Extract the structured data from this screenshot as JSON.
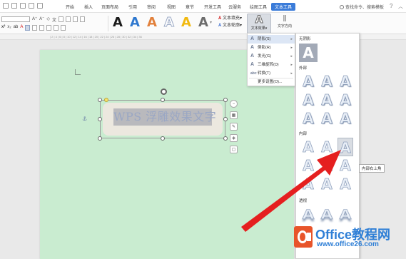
{
  "menubar": {
    "tabs": [
      "开始",
      "插入",
      "页面布局",
      "引用",
      "审阅",
      "视图",
      "章节",
      "开发工具",
      "云服务",
      "绘图工具",
      "文本工具"
    ],
    "active_tab": "文本工具",
    "search_text": "查找命令、搜索模板",
    "help": "?"
  },
  "ribbon": {
    "style_labels": [
      "A",
      "A",
      "A",
      "A",
      "A",
      "A"
    ],
    "style_colors": [
      "#1b1b1b",
      "#2e78cf",
      "#e2813c",
      "#c9d3e3",
      "#f1b90f",
      "#6c6c6c"
    ],
    "text_fill": "文本填充",
    "text_outline": "文本轮廓",
    "text_effect": "文本效果",
    "text_direction": "文字方向",
    "effect_glyph": "A"
  },
  "document": {
    "textbox_text": "WPS 浮雕效果文字"
  },
  "effect_menu": {
    "items": [
      {
        "label": "阴影(S)",
        "icon": "A",
        "has_submenu": true,
        "selected": true
      },
      {
        "label": "倒影(R)",
        "icon": "A",
        "has_submenu": true,
        "selected": false
      },
      {
        "label": "发光(G)",
        "icon": "A",
        "has_submenu": true,
        "selected": false
      },
      {
        "label": "三维旋转(D)",
        "icon": "A",
        "has_submenu": true,
        "selected": false
      },
      {
        "label": "转换(T)",
        "icon": "abc",
        "has_submenu": true,
        "selected": false
      }
    ],
    "more": "更多设置(O)..."
  },
  "shadow_gallery": {
    "no_shadow": "无阴影",
    "outer": "外部",
    "inner": "内部",
    "perspective": "透视",
    "swatch_glyph": "A",
    "tooltip": "内部右上角"
  },
  "watermark": {
    "title": "Office教程网",
    "url": "www.office26.com"
  }
}
